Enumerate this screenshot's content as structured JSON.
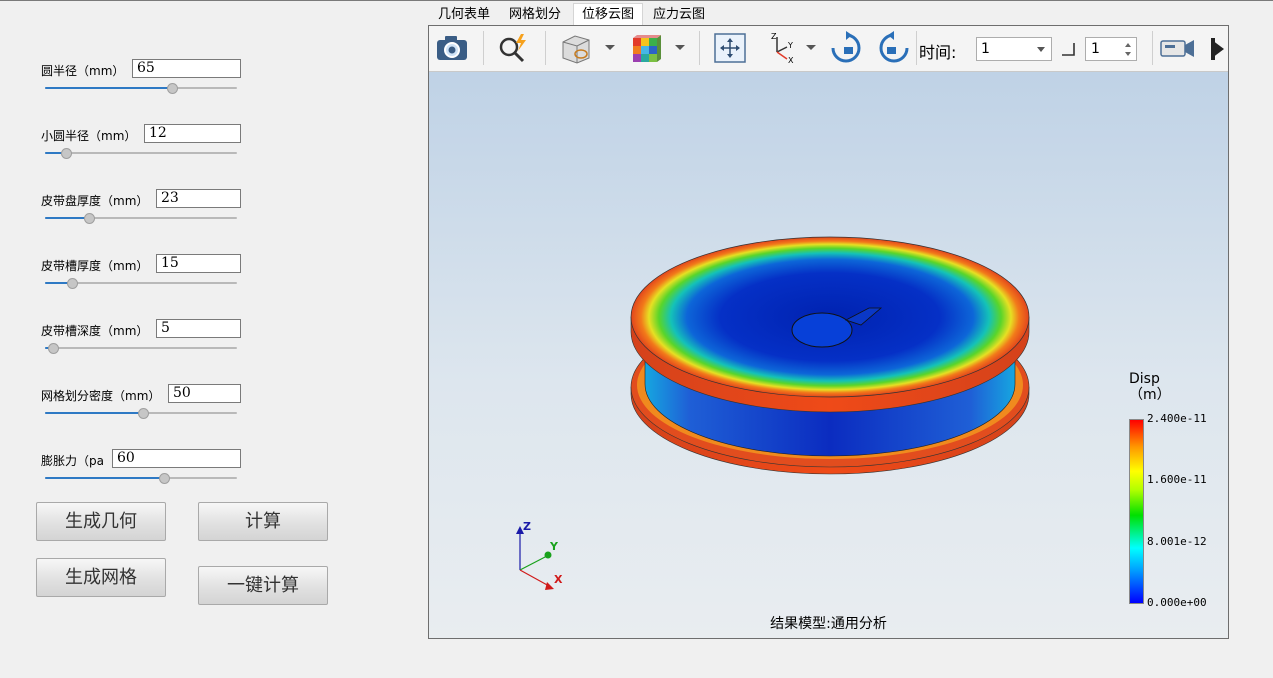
{
  "params": [
    {
      "label": "圆半径（mm）",
      "value": "65",
      "slider": 0.66
    },
    {
      "label": "小圆半径（mm）",
      "value": "12",
      "slider": 0.11
    },
    {
      "label": "皮带盘厚度（mm）",
      "value": "23",
      "slider": 0.23
    },
    {
      "label": "皮带槽厚度（mm）",
      "value": "15",
      "slider": 0.14
    },
    {
      "label": "皮带槽深度（mm）",
      "value": "5",
      "slider": 0.04
    },
    {
      "label": "网格划分密度（mm）",
      "value": "50",
      "slider": 0.51
    },
    {
      "label": "膨胀力（pa",
      "value": "60",
      "slider": 0.62
    }
  ],
  "buttons": {
    "gen_geometry": "生成几何",
    "compute": "计算",
    "gen_mesh": "生成网格",
    "one_click": "一键计算"
  },
  "tabs": [
    {
      "label": "几何表单",
      "active": false
    },
    {
      "label": "网格划分",
      "active": false
    },
    {
      "label": "位移云图",
      "active": true
    },
    {
      "label": "应力云图",
      "active": false
    }
  ],
  "toolbar": {
    "time_label": "时间:",
    "time_value": "1",
    "step_value": "1"
  },
  "legend": {
    "title": "Disp",
    "unit": "（m）",
    "ticks": [
      "2.400e-11",
      "1.600e-11",
      "8.001e-12",
      "0.000e+00"
    ]
  },
  "axes": {
    "x": "X",
    "y": "Y",
    "z": "Z"
  },
  "result_label": "结果模型:通用分析"
}
